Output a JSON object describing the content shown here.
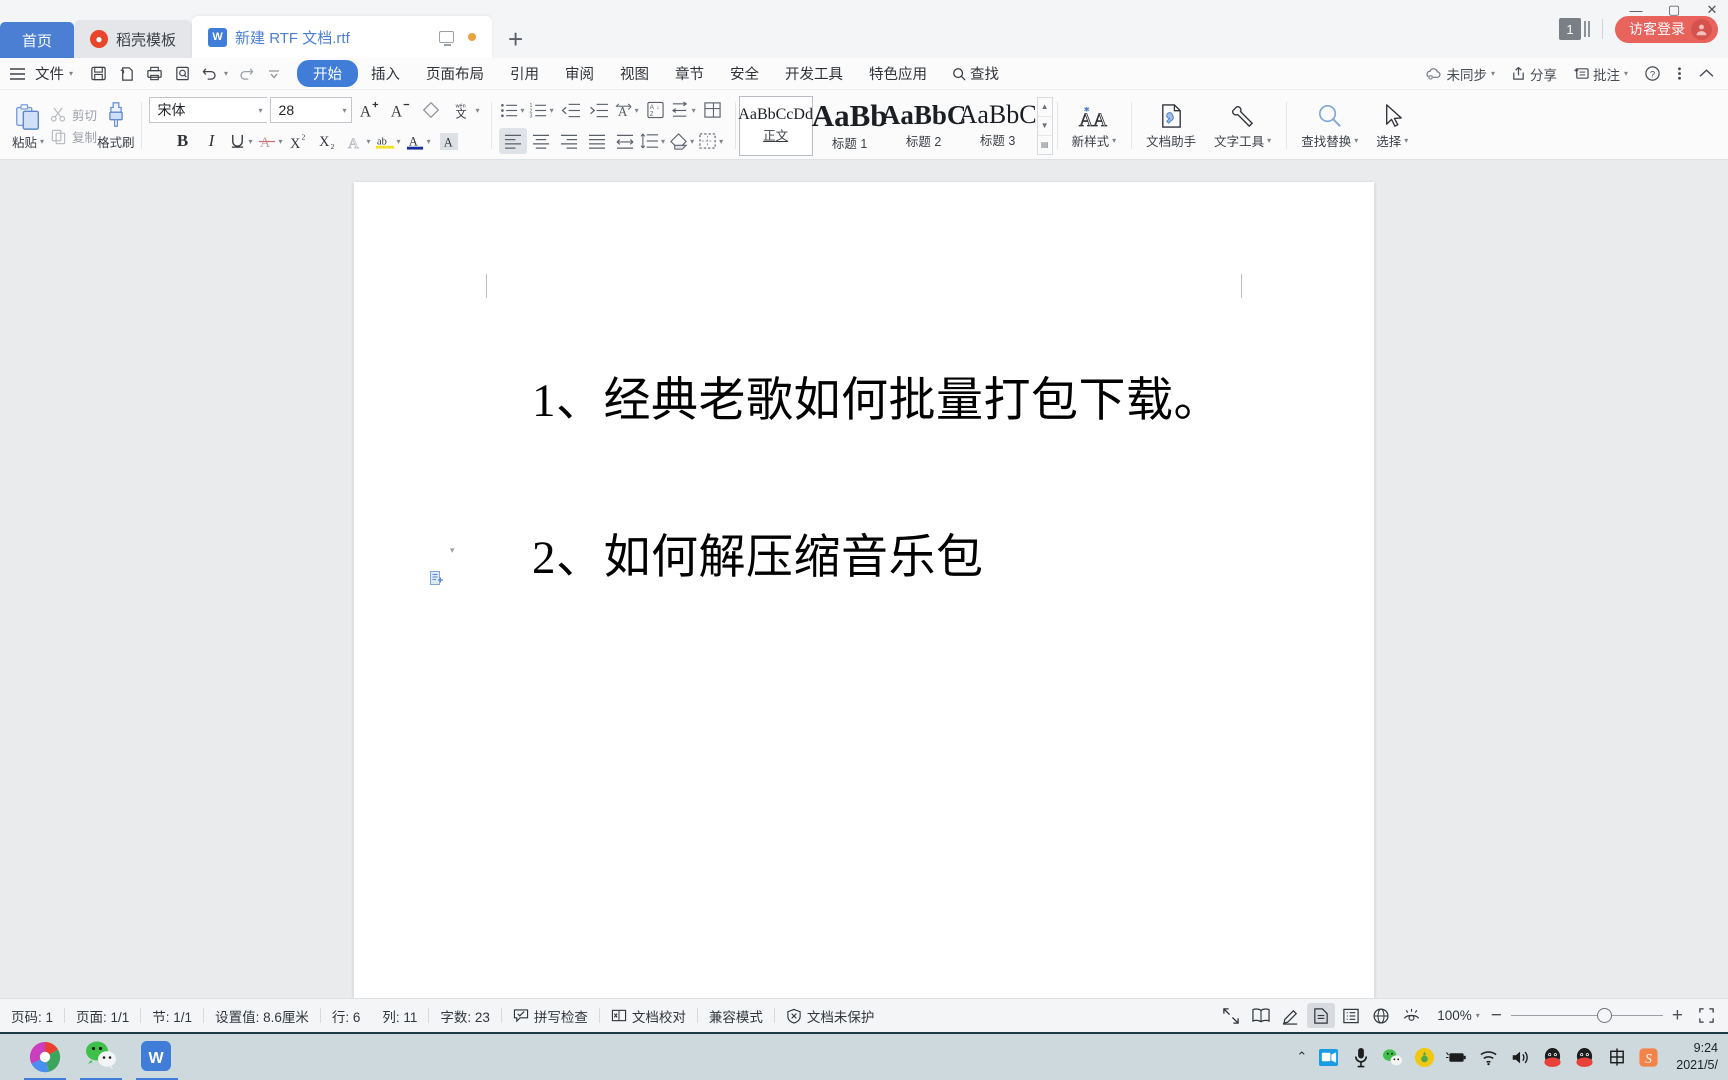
{
  "window": {
    "tabs": [
      {
        "label": "首页",
        "type": "home"
      },
      {
        "label": "稻壳模板",
        "type": "docer",
        "icon": "docer-icon"
      },
      {
        "label": "新建 RTF 文档.rtf",
        "type": "doc",
        "icon": "wps-writer-icon",
        "active": true
      }
    ],
    "new_tab_label": "+",
    "tab_badge_count": "1",
    "login_button": "访客登录",
    "minimize": "—",
    "maximize": "▢",
    "close": "✕"
  },
  "menubar": {
    "file_label": "文件",
    "quick_access": [
      "save-icon",
      "print-preview-icon",
      "print-icon",
      "search-doc-icon",
      "undo-icon",
      "redo-icon",
      "customize-icon"
    ],
    "items": [
      {
        "label": "开始",
        "active": true
      },
      {
        "label": "插入",
        "active": false
      },
      {
        "label": "页面布局",
        "active": false
      },
      {
        "label": "引用",
        "active": false
      },
      {
        "label": "审阅",
        "active": false
      },
      {
        "label": "视图",
        "active": false
      },
      {
        "label": "章节",
        "active": false
      },
      {
        "label": "安全",
        "active": false
      },
      {
        "label": "开发工具",
        "active": false
      },
      {
        "label": "特色应用",
        "active": false
      }
    ],
    "search_label": "查找",
    "right_items": [
      {
        "label": "未同步",
        "icon": "cloud-sync-icon",
        "caret": true
      },
      {
        "label": "分享",
        "icon": "share-icon",
        "caret": false
      },
      {
        "label": "批注",
        "icon": "comment-add-icon",
        "caret": true
      }
    ],
    "help_icon": "help-icon",
    "more_icon": "more-vertical-icon",
    "collapse_icon": "chevron-up-icon"
  },
  "ribbon": {
    "clipboard": {
      "paste_label": "粘贴",
      "cut_label": "剪切",
      "copy_label": "复制",
      "format_painter_label": "格式刷"
    },
    "font": {
      "family_value": "宋体",
      "size_value": "28",
      "grow_font": "A⁺",
      "shrink_font": "A⁻",
      "clear_format": "clear-format-icon",
      "pinyin_guide": "拼音指南",
      "bold": "B",
      "italic": "I",
      "underline": "U",
      "strikethrough": "A",
      "superscript": "X²",
      "subscript": "X₂",
      "text_effects": "A",
      "highlight": "ab",
      "font_color": "A",
      "char_shading": "A"
    },
    "paragraph": {
      "bullet_list": "bullet-list-icon",
      "numbered_list": "numbered-list-icon",
      "decrease_indent": "decrease-indent-icon",
      "increase_indent": "increase-indent-icon",
      "asian_layout": "asian-layout-icon",
      "sort": "sort-icon",
      "show_marks": "show-paragraph-marks-icon",
      "borders_top": "table-borders-icon",
      "align_left": "align-left-icon",
      "align_center": "align-center-icon",
      "align_right": "align-right-icon",
      "align_justify": "align-justify-icon",
      "distribute": "distribute-icon",
      "line_spacing": "line-spacing-icon",
      "shading": "shading-icon",
      "borders": "borders-icon"
    },
    "styles": [
      {
        "preview": "AaBbCcDd",
        "name": "正文",
        "selected": true,
        "size": 15
      },
      {
        "preview": "AaBb",
        "name": "标题 1",
        "selected": false,
        "size": 28
      },
      {
        "preview": "AaBbC",
        "name": "标题 2",
        "selected": false,
        "size": 24
      },
      {
        "preview": "AaBbC",
        "name": "标题 3",
        "selected": false,
        "size": 22
      }
    ],
    "new_style_label": "新样式",
    "tools": [
      {
        "label": "文档助手",
        "icon": "doc-assistant-icon",
        "caret": false
      },
      {
        "label": "文字工具",
        "icon": "text-tool-icon",
        "caret": true
      },
      {
        "label": "查找替换",
        "icon": "find-replace-icon",
        "caret": true
      },
      {
        "label": "选择",
        "icon": "select-cursor-icon",
        "caret": true
      }
    ]
  },
  "document": {
    "lines": [
      "1、经典老歌如何批量打包下载。",
      "2、如何解压缩音乐包"
    ]
  },
  "statusbar": {
    "left_items": [
      {
        "label": "页码: 1"
      },
      {
        "label": "页面: 1/1"
      },
      {
        "label": "节: 1/1"
      },
      {
        "label": "设置值: 8.6厘米"
      },
      {
        "label": "行: 6"
      },
      {
        "label": "列: 11"
      },
      {
        "label": "字数: 23"
      },
      {
        "label": "拼写检查",
        "icon": "spellcheck-icon"
      },
      {
        "label": "文档校对",
        "icon": "proofread-icon"
      },
      {
        "label": "兼容模式"
      },
      {
        "label": "文档未保护",
        "icon": "shield-unprotected-icon"
      }
    ],
    "view_icons": [
      {
        "name": "fullscreen-icon",
        "active": false
      },
      {
        "name": "book-view-icon",
        "active": false
      },
      {
        "name": "edit-pen-icon",
        "active": false
      },
      {
        "name": "page-view-icon",
        "active": true
      },
      {
        "name": "outline-view-icon",
        "active": false
      },
      {
        "name": "web-view-icon",
        "active": false
      },
      {
        "name": "eye-protect-icon",
        "active": false
      }
    ],
    "zoom_value": "100%",
    "zoom_out": "−",
    "zoom_in": "+",
    "fit_icon": "fit-page-icon"
  },
  "taskbar": {
    "apps": [
      {
        "name": "chrome-icon"
      },
      {
        "name": "wechat-icon"
      },
      {
        "name": "wps-icon"
      }
    ],
    "tray_icons": [
      "chevron-up-icon",
      "screen-record-icon",
      "microphone-icon",
      "wechat-tray-icon",
      "security-icon",
      "battery-icon",
      "wifi-icon",
      "volume-icon",
      "qq-icon",
      "qq-icon-2",
      "ime-chinese-icon",
      "sogou-icon"
    ],
    "clock_time": "9:24",
    "clock_date": "2021/5/"
  },
  "colors": {
    "accent_blue": "#3f7dd8",
    "tab_home_blue": "#4a7fd4",
    "login_red": "#e8635c",
    "docer_orange": "#e8452a",
    "taskbar": "#cdd9dd",
    "doc_bg": "#e9ebed"
  }
}
